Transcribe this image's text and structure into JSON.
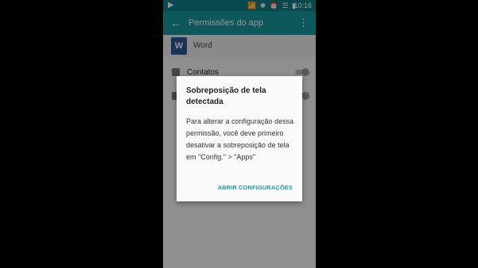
{
  "status_bar": {
    "left_icon": "▶",
    "right_icons": "📶 ✱ ⏰ ☰ ▮",
    "time": "10:16"
  },
  "app_bar": {
    "back_icon": "←",
    "title": "Permissões do app",
    "menu_icon": "⋮"
  },
  "app": {
    "icon_letter": "W",
    "name": "Word"
  },
  "permissions": [
    {
      "label": "Contatos"
    }
  ],
  "dialog": {
    "title": "Sobreposição de tela detectada",
    "body": "Para alterar a configuração dessa permissão, você deve primeiro desativar a sobreposição de tela em \"Config.\" > \"Apps\"",
    "action": "ABRIR CONFIGURAÇÕES"
  },
  "colors": {
    "status_bar": "#0e7f85",
    "app_bar": "#16989e",
    "accent": "#1f9cb4"
  }
}
